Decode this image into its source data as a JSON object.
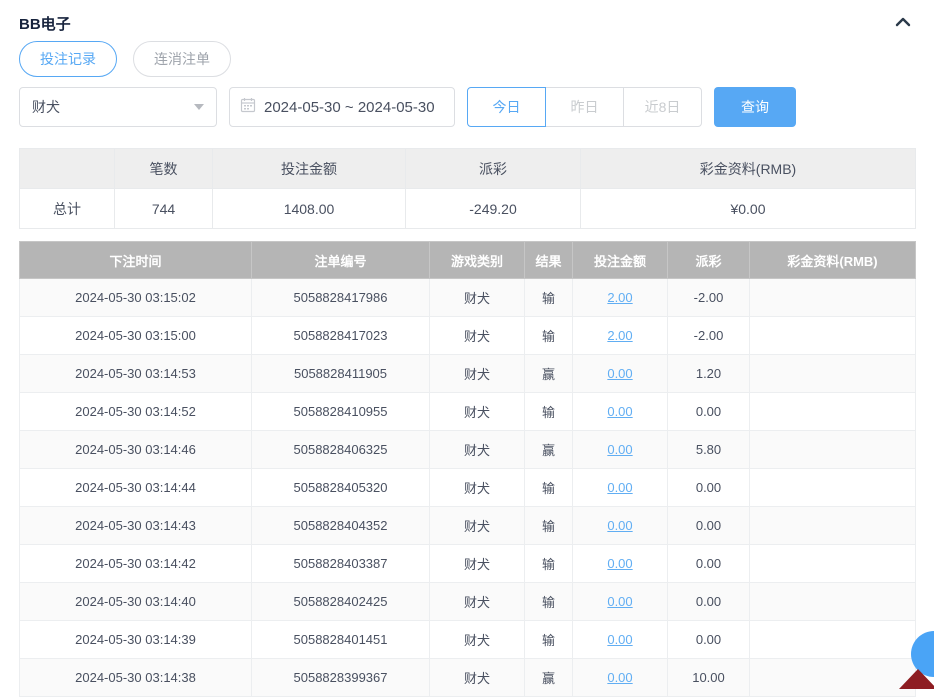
{
  "header": {
    "title": "BB电子"
  },
  "tabs": {
    "items": [
      {
        "label": "投注记录",
        "active": true
      },
      {
        "label": "连消注单",
        "active": false
      }
    ]
  },
  "filters": {
    "game_select": {
      "value": "财犬"
    },
    "date_range": {
      "value": "2024-05-30 ~ 2024-05-30"
    },
    "quick_ranges": [
      {
        "label": "今日",
        "active": true
      },
      {
        "label": "昨日",
        "active": false
      },
      {
        "label": "近8日",
        "active": false
      }
    ],
    "query_button": {
      "label": "查询"
    }
  },
  "summary": {
    "headers": [
      "",
      "笔数",
      "投注金额",
      "派彩",
      "彩金资料(RMB)"
    ],
    "row_label": "总计",
    "count": "744",
    "bet_amount": "1408.00",
    "payout": "-249.20",
    "bonus": "¥0.00"
  },
  "records": {
    "headers": [
      "下注时间",
      "注单编号",
      "游戏类别",
      "结果",
      "投注金额",
      "派彩",
      "彩金资料(RMB)"
    ],
    "rows": [
      {
        "time": "2024-05-30 03:15:02",
        "order_id": "5058828417986",
        "game": "财犬",
        "result": "输",
        "bet": "2.00",
        "payout": "-2.00",
        "bonus": ""
      },
      {
        "time": "2024-05-30 03:15:00",
        "order_id": "5058828417023",
        "game": "财犬",
        "result": "输",
        "bet": "2.00",
        "payout": "-2.00",
        "bonus": ""
      },
      {
        "time": "2024-05-30 03:14:53",
        "order_id": "5058828411905",
        "game": "财犬",
        "result": "赢",
        "bet": "0.00",
        "payout": "1.20",
        "bonus": ""
      },
      {
        "time": "2024-05-30 03:14:52",
        "order_id": "5058828410955",
        "game": "财犬",
        "result": "输",
        "bet": "0.00",
        "payout": "0.00",
        "bonus": ""
      },
      {
        "time": "2024-05-30 03:14:46",
        "order_id": "5058828406325",
        "game": "财犬",
        "result": "赢",
        "bet": "0.00",
        "payout": "5.80",
        "bonus": ""
      },
      {
        "time": "2024-05-30 03:14:44",
        "order_id": "5058828405320",
        "game": "财犬",
        "result": "输",
        "bet": "0.00",
        "payout": "0.00",
        "bonus": ""
      },
      {
        "time": "2024-05-30 03:14:43",
        "order_id": "5058828404352",
        "game": "财犬",
        "result": "输",
        "bet": "0.00",
        "payout": "0.00",
        "bonus": ""
      },
      {
        "time": "2024-05-30 03:14:42",
        "order_id": "5058828403387",
        "game": "财犬",
        "result": "输",
        "bet": "0.00",
        "payout": "0.00",
        "bonus": ""
      },
      {
        "time": "2024-05-30 03:14:40",
        "order_id": "5058828402425",
        "game": "财犬",
        "result": "输",
        "bet": "0.00",
        "payout": "0.00",
        "bonus": ""
      },
      {
        "time": "2024-05-30 03:14:39",
        "order_id": "5058828401451",
        "game": "财犬",
        "result": "输",
        "bet": "0.00",
        "payout": "0.00",
        "bonus": ""
      },
      {
        "time": "2024-05-30 03:14:38",
        "order_id": "5058828399367",
        "game": "财犬",
        "result": "赢",
        "bet": "0.00",
        "payout": "10.00",
        "bonus": ""
      }
    ]
  },
  "colors": {
    "accent_blue": "#57a8f4",
    "link_blue": "#61aef3",
    "negative_red": "#ed5050",
    "table_header_gray": "#b5b5b5"
  }
}
